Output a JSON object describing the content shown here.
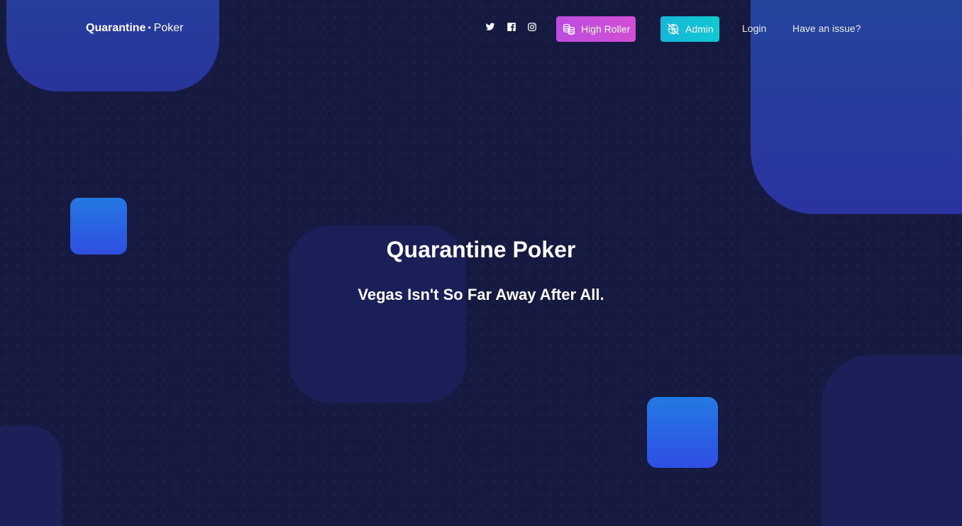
{
  "header": {
    "brand": {
      "primary": "Quarantine",
      "separator": "•",
      "secondary": "Poker"
    },
    "social": [
      {
        "icon": "twitter-icon"
      },
      {
        "icon": "facebook-icon"
      },
      {
        "icon": "instagram-icon"
      }
    ],
    "buttons": {
      "high_roller": {
        "label": "High Roller",
        "icon": "coins-icon",
        "color": "#c94ddc"
      },
      "admin": {
        "label": "Admin",
        "icon": "no-access-globe-icon",
        "color": "#12c0d5"
      }
    },
    "links": {
      "login": "Login",
      "issue": "Have an issue?"
    }
  },
  "hero": {
    "title": "Quarantine Poker",
    "subtitle": "Vegas Isn't So Far Away After All."
  },
  "theme": {
    "background": "#171a40",
    "accent_blue": "#2a5fe0"
  }
}
